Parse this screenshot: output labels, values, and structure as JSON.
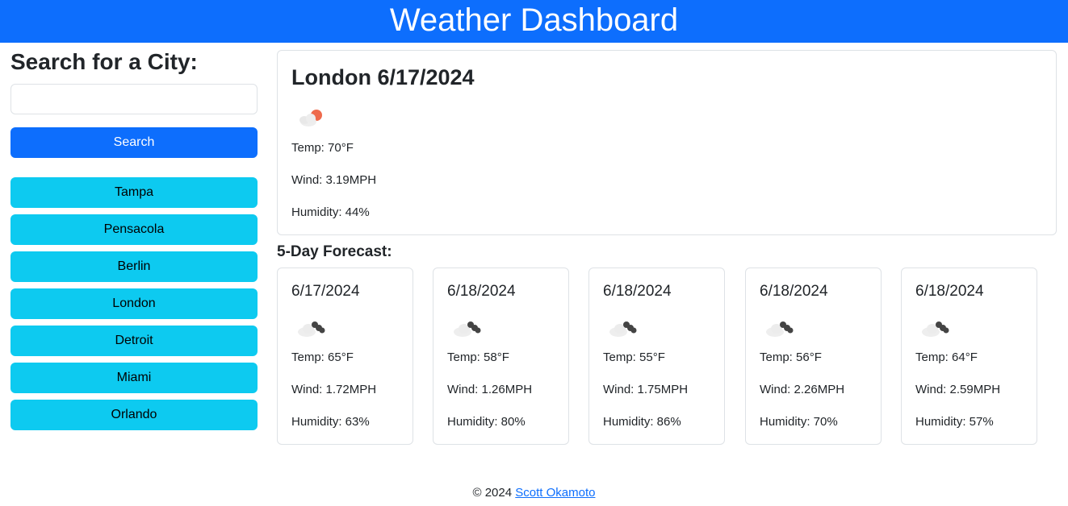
{
  "header": {
    "title": "Weather Dashboard"
  },
  "search": {
    "title": "Search for a City:",
    "input_value": "",
    "button_label": "Search"
  },
  "history": [
    "Tampa",
    "Pensacola",
    "Berlin",
    "London",
    "Detroit",
    "Miami",
    "Orlando"
  ],
  "current": {
    "title": "London 6/17/2024",
    "icon": "partly-cloudy-icon",
    "temp": "Temp: 70°F",
    "wind": "Wind: 3.19MPH",
    "humidity": "Humidity: 44%"
  },
  "forecast": {
    "title": "5-Day Forecast:",
    "days": [
      {
        "date": "6/17/2024",
        "icon": "cloudy-icon",
        "temp": "Temp: 65°F",
        "wind": "Wind: 1.72MPH",
        "humidity": "Humidity: 63%"
      },
      {
        "date": "6/18/2024",
        "icon": "cloudy-icon",
        "temp": "Temp: 58°F",
        "wind": "Wind: 1.26MPH",
        "humidity": "Humidity: 80%"
      },
      {
        "date": "6/18/2024",
        "icon": "cloudy-icon",
        "temp": "Temp: 55°F",
        "wind": "Wind: 1.75MPH",
        "humidity": "Humidity: 86%"
      },
      {
        "date": "6/18/2024",
        "icon": "cloudy-icon",
        "temp": "Temp: 56°F",
        "wind": "Wind: 2.26MPH",
        "humidity": "Humidity: 70%"
      },
      {
        "date": "6/18/2024",
        "icon": "cloudy-icon",
        "temp": "Temp: 64°F",
        "wind": "Wind: 2.59MPH",
        "humidity": "Humidity: 57%"
      }
    ]
  },
  "footer": {
    "copyright": "© 2024",
    "author_link": "Scott Okamoto"
  },
  "colors": {
    "primary": "#0d6efd",
    "info": "#0dcaf0",
    "border": "#dee2e6"
  }
}
